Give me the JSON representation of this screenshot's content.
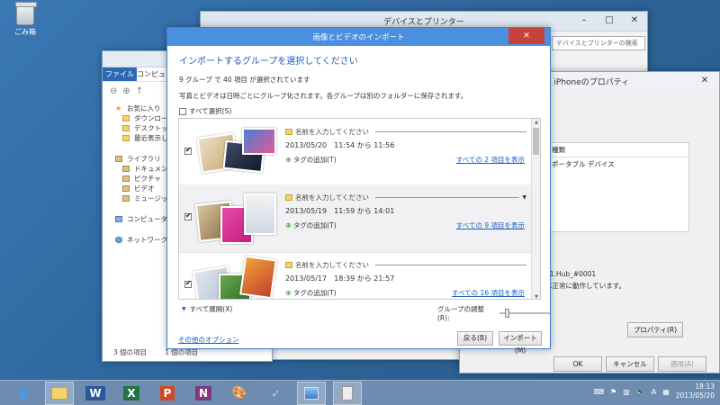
{
  "desktop": {
    "recycle_label": "ごみ箱"
  },
  "devices_window": {
    "title": "デバイスとプリンター",
    "search_placeholder": "デバイスとプリンターの検索"
  },
  "explorer": {
    "ribbon": {
      "file": "ファイル",
      "computer": "コンピュー"
    },
    "nav_items": [
      {
        "label": "お気に入り",
        "icon": "star-icon"
      },
      {
        "label": "ダウンロード",
        "icon": "download-folder-icon"
      },
      {
        "label": "デスクトップ",
        "icon": "desktop-folder-icon"
      },
      {
        "label": "最近表示した",
        "icon": "recent-folder-icon"
      },
      {
        "label": "ライブラリ",
        "icon": "library-icon"
      },
      {
        "label": "ドキュメント",
        "icon": "documents-icon"
      },
      {
        "label": "ピクチャ",
        "icon": "pictures-icon"
      },
      {
        "label": "ビデオ",
        "icon": "videos-icon"
      },
      {
        "label": "ミュージック",
        "icon": "music-icon"
      },
      {
        "label": "コンピューター",
        "icon": "computer-icon"
      },
      {
        "label": "ネットワーク",
        "icon": "network-icon"
      }
    ],
    "status_count": "3 個の項目",
    "status_selected": "1 個の項目"
  },
  "properties": {
    "title": "e iPhoneのプロパティ",
    "table_header": "種類",
    "table_row": "ポータブル デバイス",
    "info_line1": "01.Hub_#0001",
    "info_line2": "は正常に動作しています。",
    "props_button": "プロパティ(R)",
    "ok": "OK",
    "cancel": "キャンセル",
    "apply": "適用(A)"
  },
  "import_dialog": {
    "title": "画像とビデオのインポート",
    "heading": "インポートするグループを選択してください",
    "summary": "9 グループ で 40 項目 が選択されています",
    "description": "写真とビデオは日時ごとにグループ化されます。各グループは別のフォルダーに保存されます。",
    "select_all": "すべて選択(S)",
    "groups": [
      {
        "name": "名前を入力してください",
        "date": "2013/05/20　11:54 から 11:56",
        "tag": "タグの追加(T)",
        "link": "すべての 2 項目を表示",
        "checked": true
      },
      {
        "name": "名前を入力してください",
        "date": "2013/05/19　11:59 から 14:01",
        "tag": "タグの追加(T)",
        "link": "すべての 9 項目を表示",
        "checked": true
      },
      {
        "name": "名前を入力してください",
        "date": "2013/05/17　18:39 から 21:57",
        "tag": "タグの追加(T)",
        "link": "すべての 16 項目を表示",
        "checked": true
      }
    ],
    "expand_all": "すべて展開(X)",
    "group_adjust": "グループの調整(R):",
    "other_options": "その他のオプション",
    "back": "戻る(B)",
    "import": "インポート(M)"
  },
  "taskbar": {
    "apps": [
      {
        "name": "internet-explorer",
        "icon": "ie-icon"
      },
      {
        "name": "file-explorer",
        "icon": "folder-icon"
      },
      {
        "name": "word",
        "icon": "word-icon",
        "glyph": "W"
      },
      {
        "name": "excel",
        "icon": "excel-icon",
        "glyph": "X"
      },
      {
        "name": "powerpoint",
        "icon": "powerpoint-icon",
        "glyph": "P"
      },
      {
        "name": "onenote",
        "icon": "onenote-icon",
        "glyph": "N"
      },
      {
        "name": "paint",
        "icon": "paint-icon"
      },
      {
        "name": "remote",
        "icon": "remote-desktop-icon"
      },
      {
        "name": "control-panel",
        "icon": "control-panel-icon"
      },
      {
        "name": "import",
        "icon": "import-icon"
      }
    ],
    "ime": "A",
    "time": "18:13",
    "date": "2013/05/20"
  },
  "colors": {
    "accent": "#4a8fe0",
    "link": "#1a5ec2",
    "close": "#c7433a"
  }
}
